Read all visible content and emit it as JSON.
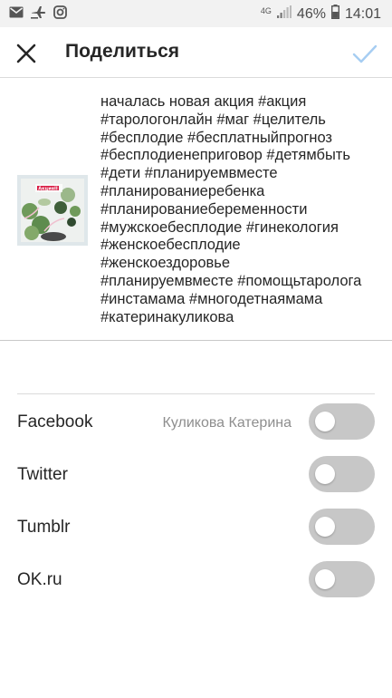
{
  "status_bar": {
    "icons_left": [
      "mail-icon",
      "airplane-icon",
      "instagram-icon"
    ],
    "network": "4G",
    "battery": "46%",
    "time": "14:01"
  },
  "header": {
    "title": "Поделиться",
    "close_icon": "close-icon",
    "confirm_icon": "checkmark-icon"
  },
  "post": {
    "image_text": "АкцияII",
    "caption": "началась новая акция #акция\n#тарологонлайн #маг #целитель\n#бесплодие #бесплатныйпрогноз\n#бесплодиенеприговор #детямбыть\n#дети #планируемвместе\n#планированиеребенка\n#планированиебеременности\n#мужскоебесплодие #гинекология\n#женскоебесплодие\n#женскоездоровье\n#планируемвместе #помощьтаролога\n#инстамама #многодетнаямама\n#катеринакуликова"
  },
  "share_targets": [
    {
      "name": "Facebook",
      "account": "Куликова Катерина",
      "enabled": false
    },
    {
      "name": "Twitter",
      "account": "",
      "enabled": false
    },
    {
      "name": "Tumblr",
      "account": "",
      "enabled": false
    },
    {
      "name": "OK.ru",
      "account": "",
      "enabled": false
    }
  ],
  "colors": {
    "accent_confirm": "#a6cdf2",
    "toggle_off": "#c7c7c7",
    "secondary_text": "#8e8e8e"
  }
}
